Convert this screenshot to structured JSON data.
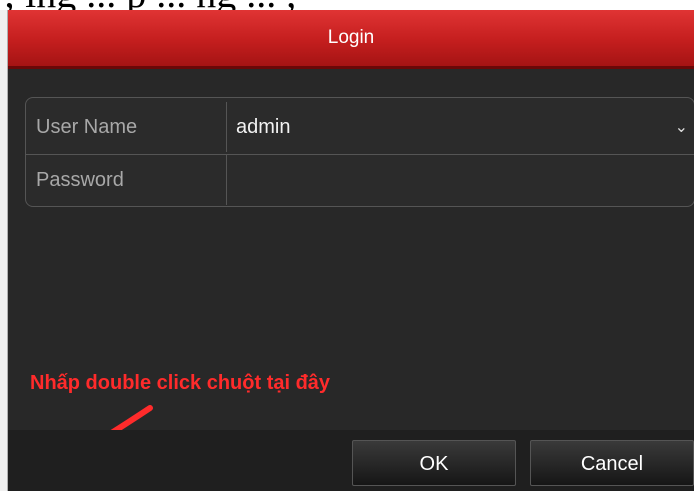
{
  "background_caption": "; ing ... p ... ng ... ,",
  "dialog": {
    "title": "Login",
    "fields": [
      {
        "label": "User Name",
        "value": "admin",
        "has_dropdown": true
      },
      {
        "label": "Password",
        "value": ""
      }
    ],
    "buttons": {
      "ok": "OK",
      "cancel": "Cancel"
    }
  },
  "annotation": {
    "text": "Nhấp double click chuột tại đây",
    "color": "#ff2b2b"
  },
  "icons": {
    "dropdown": "chevron-down-icon",
    "arrow": "arrow-down-left-icon"
  },
  "colors": {
    "title_bar": "#c41e1e",
    "dialog_bg": "#282828"
  }
}
